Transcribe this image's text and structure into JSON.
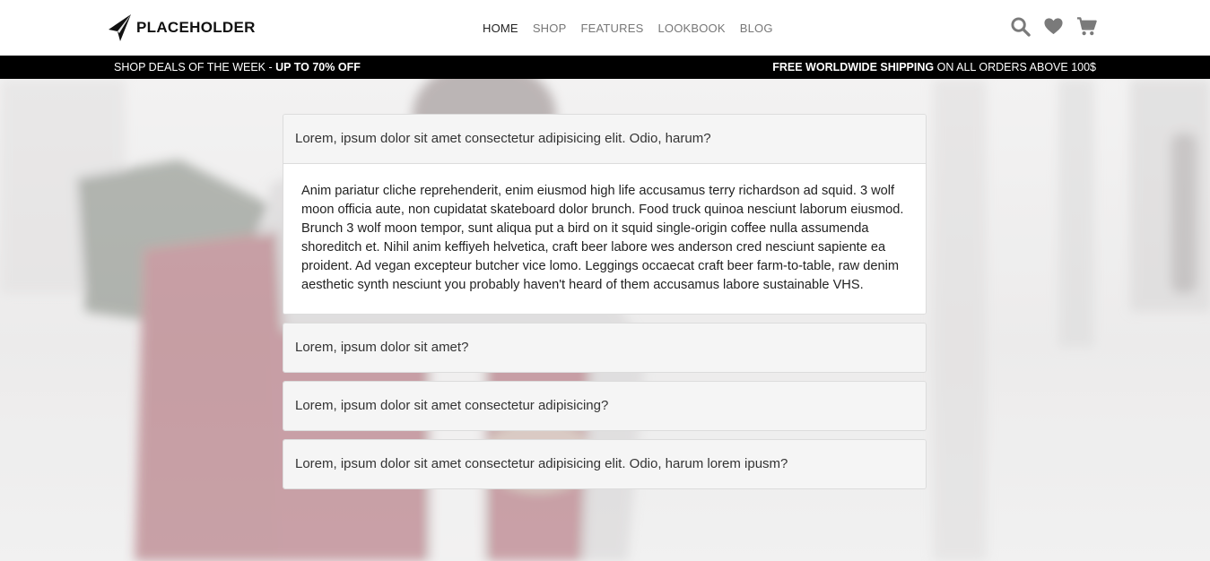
{
  "brand": {
    "name": "PLACEHOLDER",
    "logo_icon": "paper-plane-arrow-icon"
  },
  "nav": {
    "items": [
      {
        "label": "HOME",
        "active": true
      },
      {
        "label": "SHOP",
        "active": false
      },
      {
        "label": "FEATURES",
        "active": false
      },
      {
        "label": "LOOKBOOK",
        "active": false
      },
      {
        "label": "BLOG",
        "active": false
      }
    ]
  },
  "header_icons": [
    "search-icon",
    "heart-icon",
    "cart-icon"
  ],
  "colors": {
    "icon_gray": "#7a7a7a",
    "promo_bg": "#000000",
    "panel_header_bg": "#f5f5f5"
  },
  "promo": {
    "left_text": "SHOP DEALS OF THE WEEK - ",
    "left_bold": "UP TO 70% OFF",
    "right_bold": "FREE WORLDWIDE SHIPPING",
    "right_text": " ON ALL ORDERS ABOVE 100$"
  },
  "faq": {
    "items": [
      {
        "question": "Lorem, ipsum dolor sit amet consectetur adipisicing elit. Odio, harum?",
        "answer": "Anim pariatur cliche reprehenderit, enim eiusmod high life accusamus terry richardson ad squid. 3 wolf moon officia aute, non cupidatat skateboard dolor brunch. Food truck quinoa nesciunt laborum eiusmod. Brunch 3 wolf moon tempor, sunt aliqua put a bird on it squid single-origin coffee nulla assumenda shoreditch et. Nihil anim keffiyeh helvetica, craft beer labore wes anderson cred nesciunt sapiente ea proident. Ad vegan excepteur butcher vice lomo. Leggings occaecat craft beer farm-to-table, raw denim aesthetic synth nesciunt you probably haven't heard of them accusamus labore sustainable VHS.",
        "expanded": true
      },
      {
        "question": "Lorem, ipsum dolor sit amet?",
        "expanded": false
      },
      {
        "question": "Lorem, ipsum dolor sit amet consectetur adipisicing?",
        "expanded": false
      },
      {
        "question": "Lorem, ipsum dolor sit amet consectetur adipisicing elit. Odio, harum lorem ipusm?",
        "expanded": false
      }
    ]
  }
}
